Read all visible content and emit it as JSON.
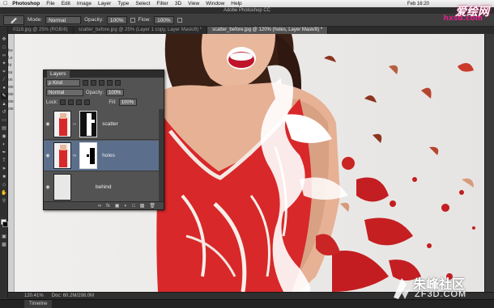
{
  "menubar": {
    "app": "Photoshop",
    "items": [
      "File",
      "Edit",
      "Image",
      "Layer",
      "Type",
      "Select",
      "Filter",
      "3D",
      "View",
      "Window",
      "Help"
    ],
    "clock": "Feb 16:20"
  },
  "app_title": "Adobe Photoshop CC",
  "options": {
    "mode_label": "Mode:",
    "mode_value": "Normal",
    "opacity_label": "Opacity:",
    "opacity_value": "100%",
    "flow_label": "Flow:",
    "flow_value": "100%"
  },
  "tabs": [
    {
      "label": "0119.jpg @ 25% (RGB/8)",
      "active": false
    },
    {
      "label": "scatter_before.jpg @ 25% (Layer 1 copy, Layer Mask/8) *",
      "active": false
    },
    {
      "label": "scatter_before.jpg @ 120% (holes, Layer Mask/8) *",
      "active": true
    }
  ],
  "left_panel_fragments": [
    "fre",
    "Le",
    "ht",
    "sa",
    "on",
    "ste",
    "ste",
    "ste",
    "ste"
  ],
  "layers_panel": {
    "title": "Layers",
    "kind_label": "ρ Kind",
    "blend_mode": "Normal",
    "opacity_label": "Opacity:",
    "opacity_value": "100%",
    "lock_label": "Lock:",
    "fill_label": "Fill:",
    "fill_value": "100%",
    "layers": [
      {
        "name": "scatter",
        "selected": false
      },
      {
        "name": "holes",
        "selected": true
      },
      {
        "name": "behind",
        "selected": false
      }
    ]
  },
  "status": {
    "zoom": "120.41%",
    "doc": "Doc: 60.2M/298.0M"
  },
  "timeline": {
    "label": "Timeline"
  },
  "watermark_top": {
    "line1": "爱绘网",
    "line2": "hxsd.com"
  },
  "watermark_bottom": {
    "line1": "朱峰社区",
    "line2": "ZF3D.COM"
  },
  "colors": {
    "dress_red": "#d8282a",
    "skin": "#e9b89c",
    "hair": "#3a1f14",
    "panel_bg": "#535353",
    "selected_layer": "#5b6f8c"
  }
}
